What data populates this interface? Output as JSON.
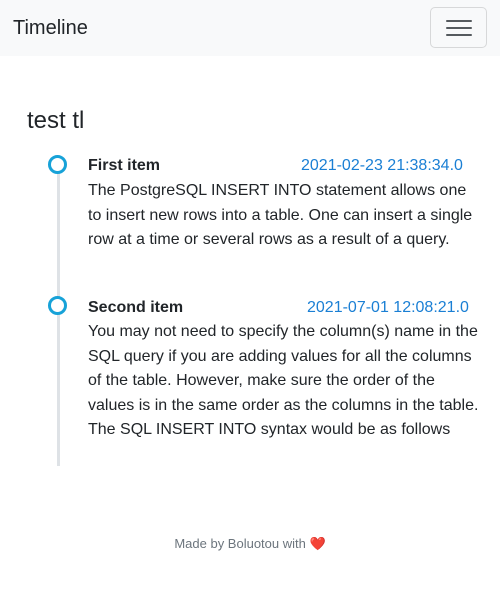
{
  "navbar": {
    "brand": "Timeline"
  },
  "page": {
    "title": "test tl"
  },
  "timeline": {
    "items": [
      {
        "title": "First item",
        "time": "2021-02-23 21:38:34.0",
        "body": "The PostgreSQL INSERT INTO statement allows one to insert new rows into a table. One can insert a single row at a time or several rows as a result of a query."
      },
      {
        "title": "Second item",
        "time": "2021-07-01 12:08:21.0",
        "body": "You may not need to specify the column(s) name in the SQL query if you are adding values for all the columns of the table. However, make sure the order of the values is in the same order as the columns in the table. The SQL INSERT INTO syntax would be as follows"
      }
    ]
  },
  "footer": {
    "text": "Made by Boluotou with",
    "heart": "❤️"
  },
  "colors": {
    "accent": "#17a2d8",
    "link": "#1a7fd4",
    "navbar_bg": "#f8f9fa"
  }
}
